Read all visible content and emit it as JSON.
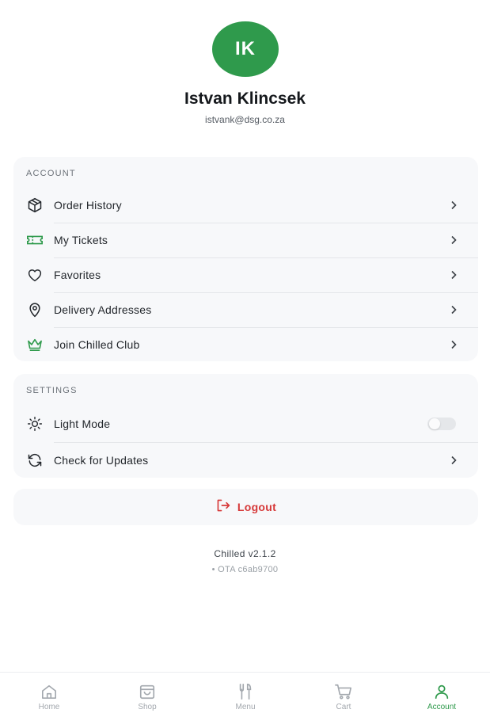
{
  "profile": {
    "initials": "IK",
    "name": "Istvan Klincsek",
    "email": "istvank@dsg.co.za"
  },
  "account": {
    "section_label": "ACCOUNT",
    "items": [
      {
        "label": "Order History",
        "icon": "box-icon"
      },
      {
        "label": "My Tickets",
        "icon": "ticket-icon"
      },
      {
        "label": "Favorites",
        "icon": "heart-icon"
      },
      {
        "label": "Delivery Addresses",
        "icon": "map-pin-icon"
      },
      {
        "label": "Join Chilled Club",
        "icon": "crown-icon"
      }
    ]
  },
  "settings": {
    "section_label": "SETTINGS",
    "light_mode_label": "Light Mode",
    "light_mode_on": false,
    "updates_label": "Check for Updates"
  },
  "logout": {
    "label": "Logout"
  },
  "footer": {
    "version": "Chilled v2.1.2",
    "ota": "• OTA c6ab9700"
  },
  "tabbar": {
    "tabs": [
      {
        "label": "Home",
        "icon": "home-icon",
        "active": false
      },
      {
        "label": "Shop",
        "icon": "shopping-bag-icon",
        "active": false
      },
      {
        "label": "Menu",
        "icon": "utensils-icon",
        "active": false
      },
      {
        "label": "Cart",
        "icon": "cart-icon",
        "active": false
      },
      {
        "label": "Account",
        "icon": "user-icon",
        "active": true
      }
    ]
  },
  "colors": {
    "brand_green": "#2f9a4c",
    "logout_red": "#d63838",
    "card_bg": "#f7f8fa",
    "inactive_tab": "#a3a8ae"
  }
}
